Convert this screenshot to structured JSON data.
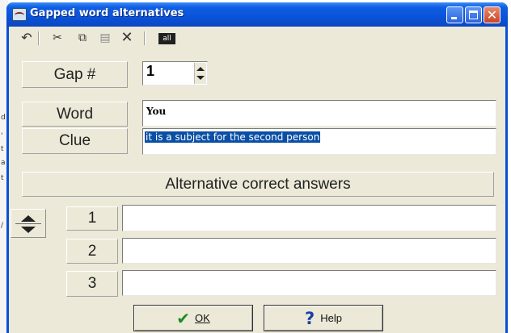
{
  "window": {
    "title": "Gapped word alternatives"
  },
  "toolbar": {
    "icons": [
      "undo-icon",
      "cut-icon",
      "copy-icon",
      "paste-icon",
      "delete-icon",
      "select-all-icon"
    ],
    "all_label": "all"
  },
  "gap": {
    "label": "Gap #",
    "value": "1"
  },
  "word": {
    "label": "Word",
    "value": "You"
  },
  "clue": {
    "label": "Clue",
    "value": "it is a subject for the second person"
  },
  "alternatives": {
    "header": "Alternative correct answers",
    "rows": [
      {
        "number": "1",
        "value": ""
      },
      {
        "number": "2",
        "value": ""
      },
      {
        "number": "3",
        "value": ""
      }
    ]
  },
  "buttons": {
    "ok_label": "OK",
    "help_label": "Help"
  }
}
